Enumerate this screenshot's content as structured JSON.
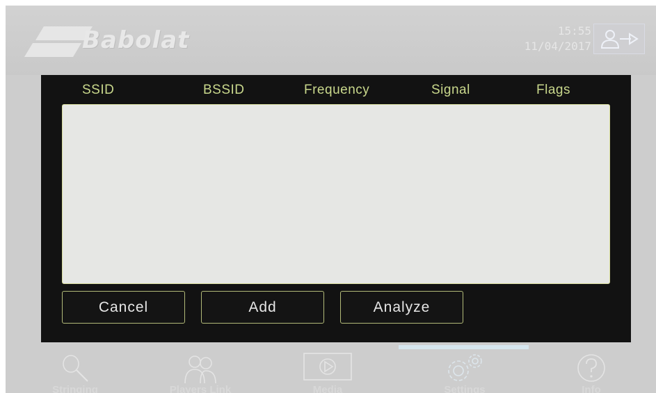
{
  "header": {
    "logo_text": "Babolat",
    "time": "15:55",
    "date": "11/04/2017"
  },
  "dialog": {
    "columns": [
      "SSID",
      "BSSID",
      "Frequency",
      "Signal",
      "Flags"
    ],
    "networks": [],
    "buttons": {
      "cancel": "Cancel",
      "add": "Add",
      "analyze": "Analyze"
    }
  },
  "nav": {
    "items": [
      {
        "label": "Stringing",
        "icon": "racquet-icon"
      },
      {
        "label": "Players Link",
        "icon": "players-icon"
      },
      {
        "label": "Media",
        "icon": "play-icon"
      },
      {
        "label": "Settings",
        "icon": "gears-icon",
        "active": true
      },
      {
        "label": "Info",
        "icon": "help-icon"
      }
    ]
  },
  "colors": {
    "header_text": "#c9d88c",
    "panel_bg": "#121212",
    "list_bg": "#e6e7e4",
    "active_indicator": "#d6e6ee"
  }
}
